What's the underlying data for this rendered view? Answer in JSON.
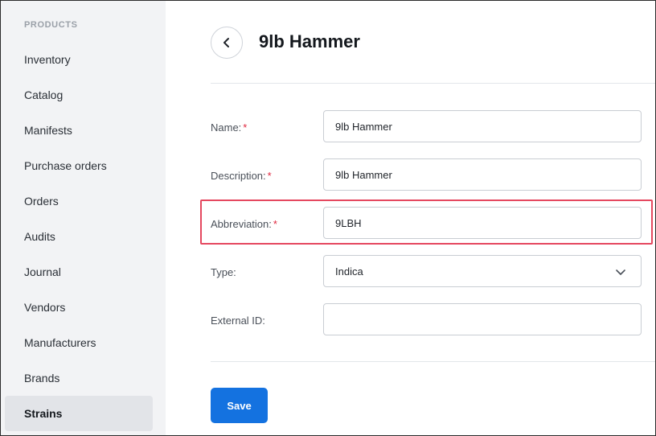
{
  "sidebar": {
    "heading": "PRODUCTS",
    "items": [
      {
        "label": "Inventory"
      },
      {
        "label": "Catalog"
      },
      {
        "label": "Manifests"
      },
      {
        "label": "Purchase orders"
      },
      {
        "label": "Orders"
      },
      {
        "label": "Audits"
      },
      {
        "label": "Journal"
      },
      {
        "label": "Vendors"
      },
      {
        "label": "Manufacturers"
      },
      {
        "label": "Brands"
      },
      {
        "label": "Strains"
      }
    ],
    "active_item": "Strains"
  },
  "header": {
    "title": "9lb Hammer",
    "back_icon": "chevron-left-icon"
  },
  "form": {
    "name": {
      "label": "Name:",
      "required_mark": "*",
      "value": "9lb Hammer"
    },
    "description": {
      "label": "Description:",
      "required_mark": "*",
      "value": "9lb Hammer"
    },
    "abbreviation": {
      "label": "Abbreviation:",
      "required_mark": "*",
      "value": "9LBH"
    },
    "type": {
      "label": "Type:",
      "value": "Indica",
      "icon": "chevron-down-icon"
    },
    "external_id": {
      "label": "External ID:",
      "value": ""
    },
    "save_label": "Save"
  },
  "colors": {
    "accent": "#1472e0",
    "highlight": "#e5485f",
    "required": "#e0283f",
    "sidebar_bg": "#f2f3f5"
  }
}
